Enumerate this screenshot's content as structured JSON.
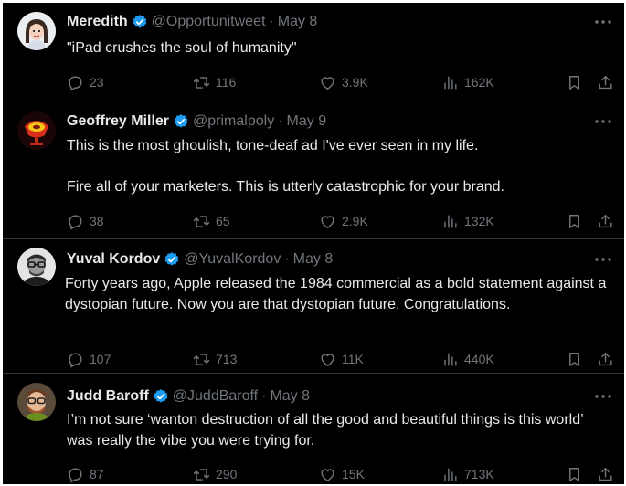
{
  "tweets": [
    {
      "name": "Meredith",
      "handle": "@Opportunitweet",
      "sep": "·",
      "date": "May 8",
      "text": [
        "\"iPad crushes the soul of humanity\""
      ],
      "replies": "23",
      "retweets": "116",
      "likes": "3.9K",
      "views": "162K"
    },
    {
      "name": "Geoffrey Miller",
      "handle": "@primalpoly",
      "sep": "·",
      "date": "May 9",
      "text": [
        "This is the most ghoulish, tone-deaf ad I've ever seen in my life.",
        "Fire all of your marketers. This is utterly catastrophic for your brand."
      ],
      "replies": "38",
      "retweets": "65",
      "likes": "2.9K",
      "views": "132K"
    },
    {
      "name": "Yuval Kordov",
      "handle": "@YuvalKordov",
      "sep": "·",
      "date": "May 8",
      "text": [
        "Forty years ago, Apple released the 1984 commercial as a bold statement against a dystopian future. Now you are that dystopian future. Congratulations."
      ],
      "replies": "107",
      "retweets": "713",
      "likes": "11K",
      "views": "440K"
    },
    {
      "name": "Judd Baroff",
      "handle": "@JuddBaroff",
      "sep": "·",
      "date": "May 8",
      "text": [
        "I’m not sure ‘wanton destruction of all the good and beautiful things is this world’ was really the vibe you were trying for."
      ],
      "replies": "87",
      "retweets": "290",
      "likes": "15K",
      "views": "713K"
    }
  ],
  "colors": {
    "background": "#000000",
    "text": "#e7e9ea",
    "muted": "#71767b",
    "verified": "#1d9bf0",
    "divider": "#2f3336"
  },
  "icons": [
    "verified-badge-icon",
    "more-icon",
    "reply-icon",
    "retweet-icon",
    "like-icon",
    "views-icon",
    "bookmark-icon",
    "share-icon"
  ]
}
